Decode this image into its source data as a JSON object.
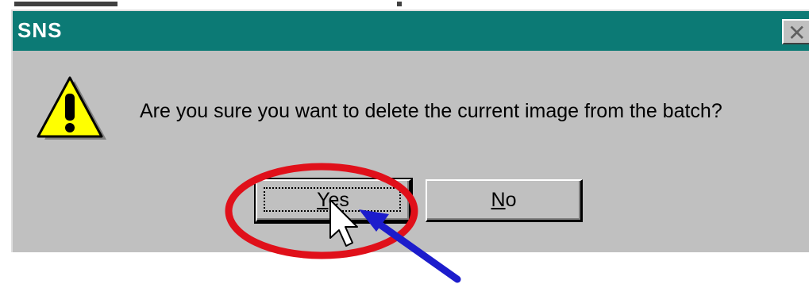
{
  "dialog": {
    "title": "SNS",
    "message": "Are you sure you want to delete the current image from the batch?",
    "close_icon": "close-icon",
    "warning_icon": "warning-icon"
  },
  "buttons": {
    "yes_prefix": "Y",
    "yes_rest": "es",
    "no_prefix": "N",
    "no_rest": "o"
  },
  "annotations": {
    "highlight_color": "#e0101a",
    "arrow_color": "#1c1ccc",
    "cursor": "mouse-pointer-icon"
  },
  "colors": {
    "titlebar": "#0c7a75",
    "dialog_face": "#c0c0c0"
  }
}
